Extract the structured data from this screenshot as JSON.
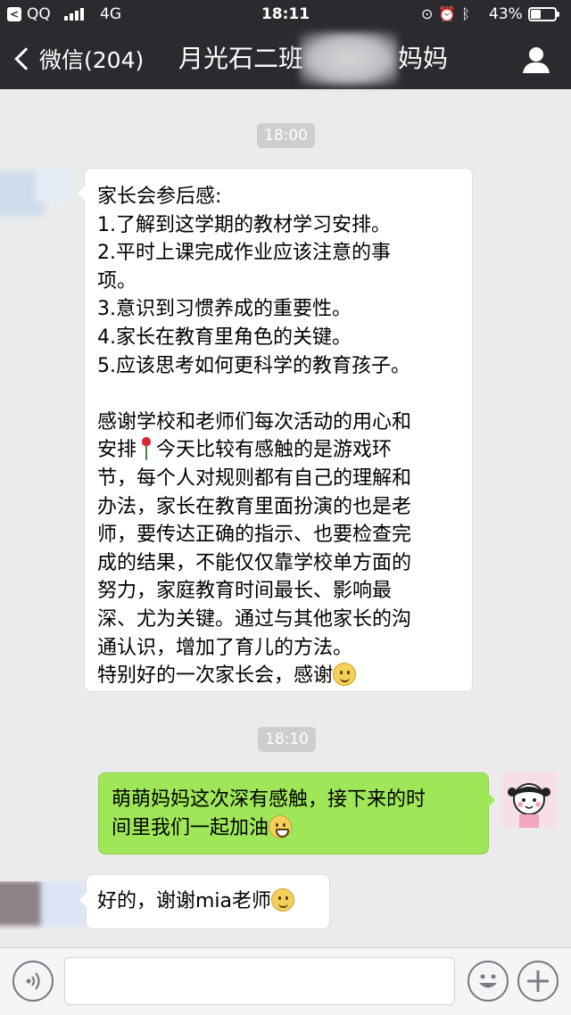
{
  "status_bar": {
    "back_app": "QQ",
    "network": "4G",
    "time": "18:11",
    "battery_percent": "43%",
    "battery_level": 0.43
  },
  "nav": {
    "back_label": "微信(204)",
    "title_left": "月光石二班",
    "title_right": "妈妈",
    "profile_icon": "person-icon"
  },
  "chat": {
    "time_1": "18:00",
    "msg_1_lines": [
      "家长会参后感:",
      "1.了解到这学期的教材学习安排。",
      "2.平时上课完成作业应该注意的事",
      "项。",
      "3.意识到习惯养成的重要性。",
      "4.家长在教育里角色的关键。",
      "5.应该思考如何更科学的教育孩子。",
      "",
      "感谢学校和老师们每次活动的用心和",
      "安排",
      "今天比较有感触的是游戏环",
      "节，每个人对规则都有自己的理解和",
      "办法，家长在教育里面扮演的也是老",
      "师，要传达正确的指示、也要检查完",
      "成的结果，不能仅仅靠学校单方面的",
      "努力，家庭教育时间最长、影响最",
      "深、尤为关键。通过与其他家长的沟",
      "通认识，增加了育儿的方法。",
      "特别好的一次家长会，感谢"
    ],
    "time_2": "18:10",
    "msg_2_lines": [
      "萌萌妈妈这次深有感触，接下来的时",
      "间里我们一起加油"
    ],
    "msg_3": "好的，谢谢mia老师"
  },
  "input_bar": {
    "voice_icon": "voice-icon",
    "emoji_icon": "emoji-icon",
    "plus_icon": "plus-icon",
    "input_value": ""
  },
  "colors": {
    "nav_bg": "#2b2b2f",
    "chat_bg": "#ebebeb",
    "outgoing_bubble": "#9fe658",
    "incoming_bubble": "#ffffff"
  }
}
